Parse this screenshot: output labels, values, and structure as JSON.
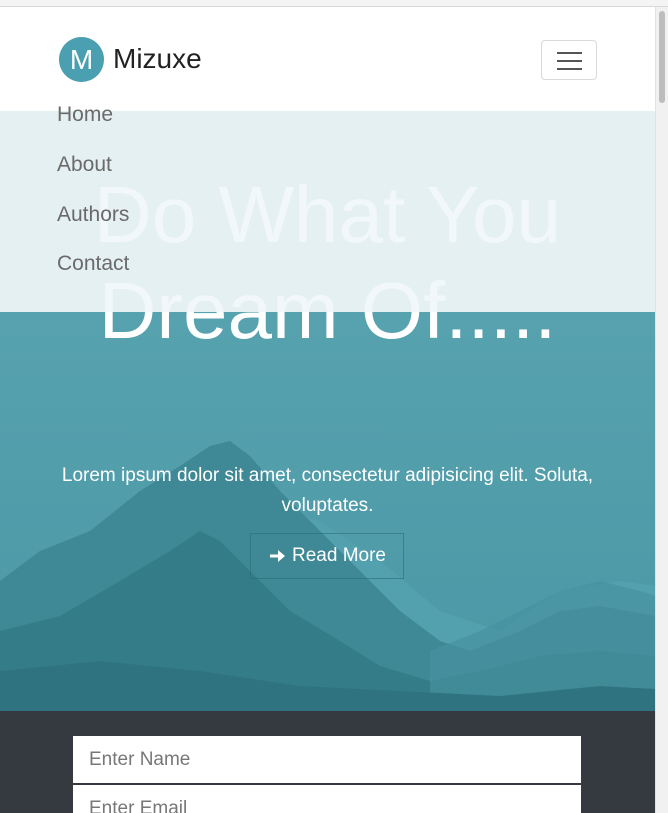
{
  "brand": {
    "logo_letter": "M",
    "name": "Mizuxe"
  },
  "nav": {
    "items": [
      {
        "label": "Home"
      },
      {
        "label": "About"
      },
      {
        "label": "Authors"
      },
      {
        "label": "Contact"
      }
    ]
  },
  "hero": {
    "title": "Do What You Dream Of.....",
    "subtitle": "Lorem ipsum dolor sit amet, consectetur adipisicing elit. Soluta, voluptates.",
    "button_label": "Read More",
    "button_icon": "arrow-right-icon"
  },
  "form": {
    "name_placeholder": "Enter Name",
    "email_placeholder": "Enter Email"
  },
  "colors": {
    "brand_accent": "#4a9fb0",
    "hero_overlay": "#5ea8b5",
    "form_background": "#343a40"
  }
}
